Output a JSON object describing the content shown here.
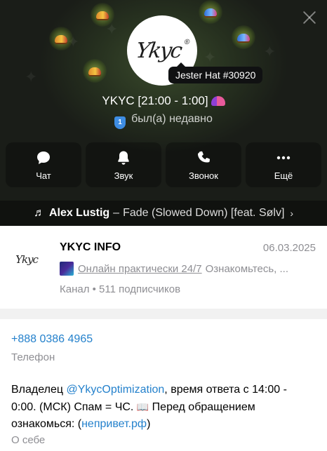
{
  "header": {
    "tooltip": "Jester Hat #30920",
    "profile_name": "YKYC [21:00 - 1:00]",
    "boost_level": "1",
    "status": "был(а) недавно",
    "avatar_logo": "Ykyc",
    "avatar_logo_mark": "®",
    "actions": [
      {
        "label": "Чат",
        "icon": "chat-icon"
      },
      {
        "label": "Звук",
        "icon": "bell-icon"
      },
      {
        "label": "Звонок",
        "icon": "phone-icon"
      },
      {
        "label": "Ещё",
        "icon": "more-icon"
      }
    ],
    "music": {
      "note": "♬",
      "artist": "Alex Lustig",
      "separator": "–",
      "track": "Fade (Slowed Down) [feat. Sølv]",
      "chevron": "›"
    }
  },
  "channel": {
    "avatar_logo": "Ykyc",
    "title": "YKYC INFO",
    "date": "06.03.2025",
    "preview_link": "Онлайн практически 24/7",
    "preview_rest": "Ознакомьтесь, ...",
    "meta": "Канал • 511 подписчиков"
  },
  "info": {
    "phone": "+888 0386 4965",
    "phone_label": "Телефон",
    "bio_part1": "Владелец ",
    "bio_mention": "@YkycOptimization",
    "bio_part2": ", время ответа с 14:00 - 0:00. (МСК) Спам = ЧС. ",
    "bio_book": "📖",
    "bio_part3": " Перед обращением ознакомься: (",
    "bio_link": "непривет.рф",
    "bio_part4": ")",
    "bio_label": "О себе"
  }
}
